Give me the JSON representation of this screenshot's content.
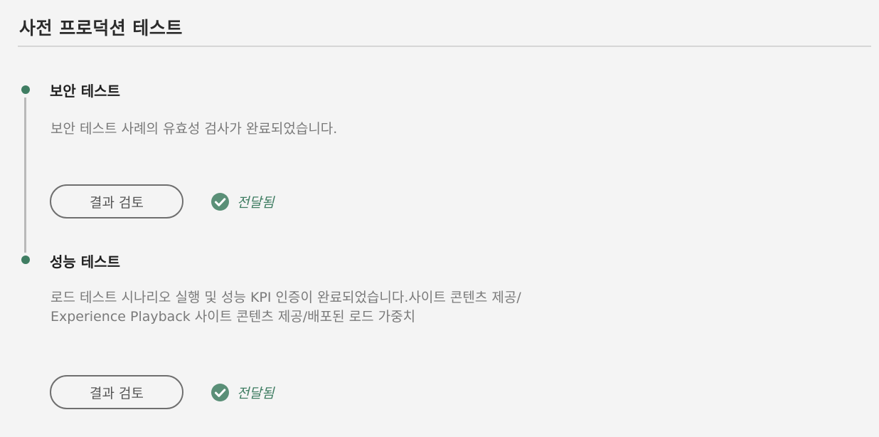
{
  "page": {
    "title": "사전 프로덕션 테스트"
  },
  "steps": [
    {
      "title": "보안 테스트",
      "description_lines": [
        "보안 테스트 사례의 유효성 검사가 완료되었습니다."
      ],
      "button_label": "결과 검토",
      "status_label": "전달됨",
      "status_icon": "check-circle-icon"
    },
    {
      "title": "성능 테스트",
      "description_lines": [
        "로드 테스트 시나리오 실행 및 성능 KPI 인증이 완료되었습니다.사이트 콘텐츠 제공/",
        "Experience Playback 사이트 콘텐츠 제공/배포된 로드 가중치"
      ],
      "button_label": "결과 검토",
      "status_label": "전달됨",
      "status_icon": "check-circle-icon"
    }
  ],
  "colors": {
    "accent_green": "#3f7d62",
    "background": "#f4f4f4",
    "timeline_line": "#b9b9b9",
    "divider": "#d6d6d6"
  }
}
